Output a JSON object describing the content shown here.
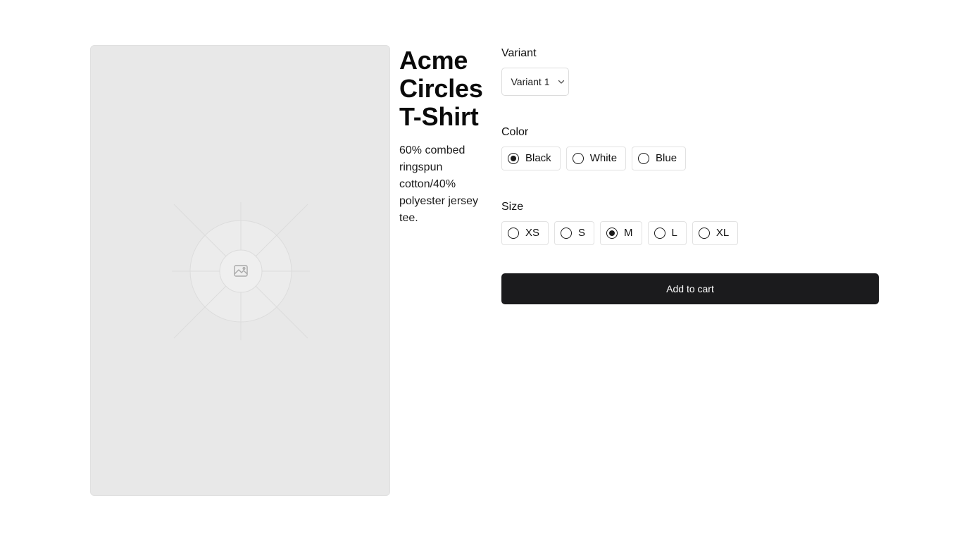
{
  "product": {
    "title": "Acme Circles T-Shirt",
    "description": "60% combed ringspun cotton/40% polyester jersey tee.",
    "image_icon": "image-placeholder-icon"
  },
  "variant": {
    "label": "Variant",
    "selected": "Variant 1",
    "icon": "chevron-down-icon"
  },
  "color": {
    "label": "Color",
    "options": [
      {
        "label": "Black",
        "selected": true
      },
      {
        "label": "White",
        "selected": false
      },
      {
        "label": "Blue",
        "selected": false
      }
    ]
  },
  "size": {
    "label": "Size",
    "options": [
      {
        "label": "XS",
        "selected": false
      },
      {
        "label": "S",
        "selected": false
      },
      {
        "label": "M",
        "selected": true
      },
      {
        "label": "L",
        "selected": false
      },
      {
        "label": "XL",
        "selected": false
      }
    ]
  },
  "cart": {
    "button_label": "Add to cart",
    "button_color": "#1b1b1d"
  }
}
